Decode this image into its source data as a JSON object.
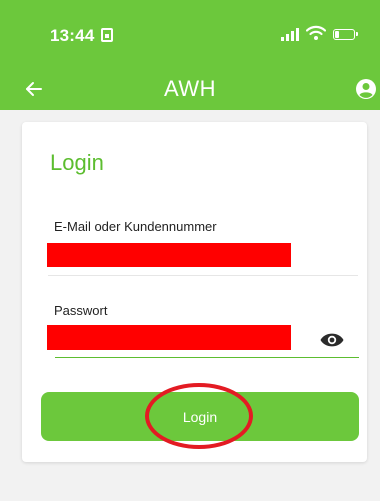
{
  "status_bar": {
    "time": "13:44",
    "icons": [
      "sim-card-icon",
      "signal-icon",
      "wifi-icon",
      "battery-icon"
    ],
    "battery_level": 0.2
  },
  "app_bar": {
    "title": "AWH",
    "back_icon": "arrow-left-icon",
    "account_icon": "account-circle-icon",
    "background_color": "#6cc83c"
  },
  "login_form": {
    "title": "Login",
    "email": {
      "label": "E-Mail oder Kundennummer",
      "value": ""
    },
    "password": {
      "label": "Passwort",
      "value": "",
      "toggle_icon": "eye-icon"
    },
    "submit_label": "Login",
    "accent_color": "#5cbd2f"
  },
  "annotation": {
    "highlight_color": "#e31b23",
    "redaction_color": "#ff0000"
  }
}
